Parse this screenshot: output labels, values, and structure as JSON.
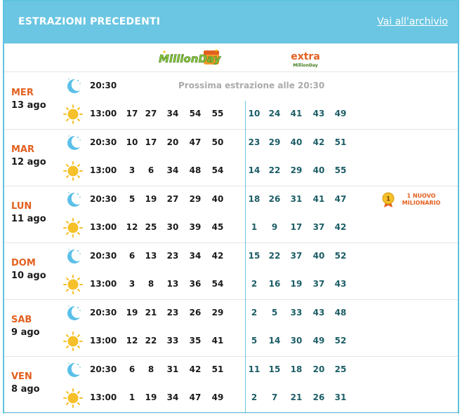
{
  "header": {
    "title": "ESTRAZIONI PRECEDENTI",
    "archive_link": "Vai all'archivio"
  },
  "logos": {
    "millionday": "MillionDay",
    "extra_top": "extra",
    "extra_sub": "MillionDay"
  },
  "icons": {
    "evening": "moon-icon",
    "afternoon": "sun-icon",
    "medal": "medal-icon"
  },
  "colors": {
    "header_bg": "#6ac6e2",
    "day_name": "#e2601f",
    "extra_numbers": "#1c5d66",
    "next_draw_text": "#aaaaaa",
    "divider": "#6ac6e2"
  },
  "days": [
    {
      "name": "MER",
      "date": "13 ago",
      "draws": [
        {
          "time": "20:30",
          "type": "moon",
          "next_label": "Prossima estrazione alle 20:30",
          "main": [],
          "extra": [],
          "badge": ""
        },
        {
          "time": "13:00",
          "type": "sun",
          "next_label": "",
          "main": [
            "17",
            "27",
            "34",
            "54",
            "55"
          ],
          "extra": [
            "10",
            "24",
            "41",
            "43",
            "49"
          ],
          "badge": ""
        }
      ]
    },
    {
      "name": "MAR",
      "date": "12 ago",
      "draws": [
        {
          "time": "20:30",
          "type": "moon",
          "next_label": "",
          "main": [
            "10",
            "17",
            "20",
            "47",
            "50"
          ],
          "extra": [
            "23",
            "29",
            "40",
            "42",
            "51"
          ],
          "badge": ""
        },
        {
          "time": "13:00",
          "type": "sun",
          "next_label": "",
          "main": [
            "3",
            "6",
            "34",
            "48",
            "54"
          ],
          "extra": [
            "14",
            "22",
            "29",
            "40",
            "55"
          ],
          "badge": ""
        }
      ]
    },
    {
      "name": "LUN",
      "date": "11 ago",
      "draws": [
        {
          "time": "20:30",
          "type": "moon",
          "next_label": "",
          "main": [
            "5",
            "19",
            "27",
            "29",
            "40"
          ],
          "extra": [
            "18",
            "26",
            "31",
            "41",
            "47"
          ],
          "badge": "1 NUOVO MILIONARIO",
          "badge_num": "1"
        },
        {
          "time": "13:00",
          "type": "sun",
          "next_label": "",
          "main": [
            "12",
            "25",
            "30",
            "39",
            "45"
          ],
          "extra": [
            "1",
            "9",
            "17",
            "37",
            "42"
          ],
          "badge": ""
        }
      ]
    },
    {
      "name": "DOM",
      "date": "10 ago",
      "draws": [
        {
          "time": "20:30",
          "type": "moon",
          "next_label": "",
          "main": [
            "6",
            "13",
            "23",
            "34",
            "42"
          ],
          "extra": [
            "15",
            "22",
            "37",
            "40",
            "52"
          ],
          "badge": ""
        },
        {
          "time": "13:00",
          "type": "sun",
          "next_label": "",
          "main": [
            "3",
            "8",
            "13",
            "36",
            "54"
          ],
          "extra": [
            "2",
            "16",
            "19",
            "37",
            "43"
          ],
          "badge": ""
        }
      ]
    },
    {
      "name": "SAB",
      "date": "9 ago",
      "draws": [
        {
          "time": "20:30",
          "type": "moon",
          "next_label": "",
          "main": [
            "19",
            "21",
            "23",
            "26",
            "29"
          ],
          "extra": [
            "2",
            "5",
            "33",
            "43",
            "48"
          ],
          "badge": ""
        },
        {
          "time": "13:00",
          "type": "sun",
          "next_label": "",
          "main": [
            "12",
            "22",
            "33",
            "35",
            "41"
          ],
          "extra": [
            "5",
            "14",
            "30",
            "49",
            "52"
          ],
          "badge": ""
        }
      ]
    },
    {
      "name": "VEN",
      "date": "8 ago",
      "draws": [
        {
          "time": "20:30",
          "type": "moon",
          "next_label": "",
          "main": [
            "6",
            "8",
            "31",
            "42",
            "51"
          ],
          "extra": [
            "11",
            "15",
            "18",
            "20",
            "25"
          ],
          "badge": ""
        },
        {
          "time": "13:00",
          "type": "sun",
          "next_label": "",
          "main": [
            "1",
            "19",
            "34",
            "47",
            "49"
          ],
          "extra": [
            "2",
            "7",
            "21",
            "26",
            "31"
          ],
          "badge": ""
        }
      ]
    }
  ]
}
